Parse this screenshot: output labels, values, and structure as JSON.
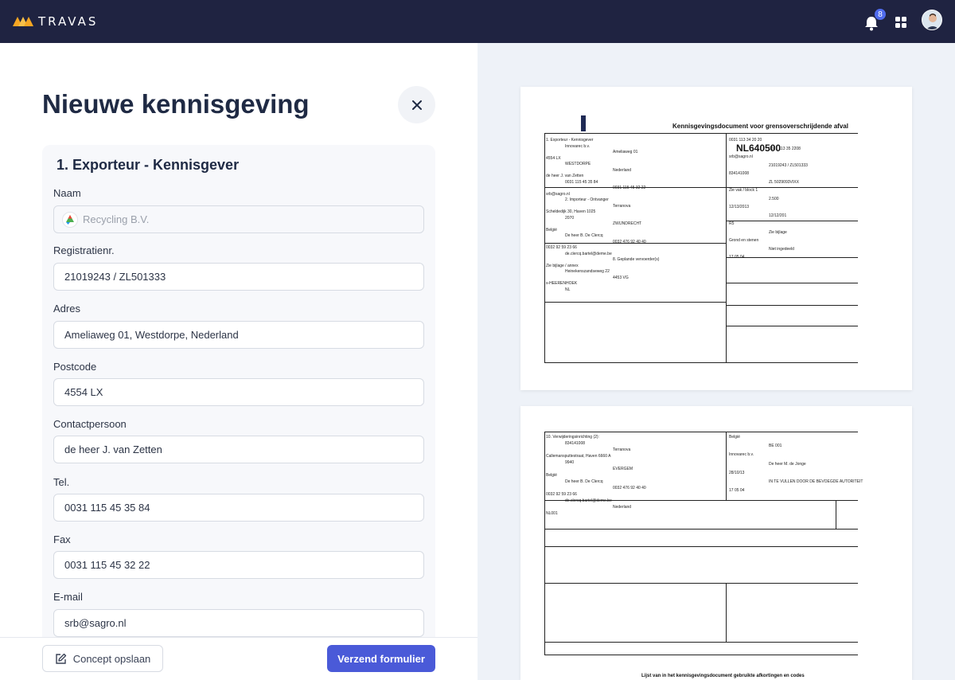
{
  "app": {
    "name": "TRAVAS",
    "notification_count": "8"
  },
  "form": {
    "title": "Nieuwe kennisgeving",
    "section_title": "1. Exporteur - Kennisgever",
    "fields": [
      {
        "label": "Naam",
        "value": "Recycling B.V."
      },
      {
        "label": "Registratienr.",
        "value": "21019243 / ZL501333"
      },
      {
        "label": "Adres",
        "value": "Ameliaweg 01, Westdorpe, Nederland"
      },
      {
        "label": "Postcode",
        "value": "4554 LX"
      },
      {
        "label": "Contactpersoon",
        "value": "de heer J. van Zetten"
      },
      {
        "label": "Tel.",
        "value": "0031 115 45 35 84"
      },
      {
        "label": "Fax",
        "value": "0031 115 45 32 22"
      },
      {
        "label": "E-mail",
        "value": "srb@sagro.nl"
      }
    ],
    "draft_button": "Concept opslaan",
    "submit_button": "Verzend formulier"
  },
  "document": {
    "title": "Kennisgevingsdocument voor grensoverschrijdende afval",
    "notification_code": "NL640500",
    "page1_lines": [
      "1. Exporteur - Kennisgever",
      "Innovarec b.v.",
      "Ameliaweg 01",
      "4554 LX",
      "WESTDORPE",
      "Nederland",
      "de heer J. van Zetten",
      "0031 115 45 35 84",
      "0031 115 45 32 22",
      "srb@sagro.nl",
      "2. Importeur - Ontvanger",
      "Terranova",
      "Scheldedijk 30, Haven 1025",
      "2070",
      "ZWIJNDRECHT",
      "België",
      "De heer B. De Clercq",
      "0032 476 92 40 40",
      "0032 92 59 23 66",
      "de.clercq.bartel@deme.be",
      "8. Geplande vervoerder(s)",
      "Zie bijlage / annex",
      "Heinekenszandseweg 22",
      "4453 VG",
      "s-HEERENHOEK",
      "NL",
      "0031 113 34 20 20",
      "0031 113 35 2208",
      "srb@sagro.nl",
      "21019243 / ZL501333",
      "834141008",
      "ZL 5029093VIXX",
      "Zie vak / block 1",
      "2.500",
      "12/13/2013",
      "12/12/201",
      "R5",
      "Zie bijlage",
      "Grond en stenen",
      "Niet ingedeeld",
      "17 05 04"
    ],
    "page2_lines": [
      "10. Verwijderingsinrichting (2):",
      "834141008",
      "Terranova",
      "Callemansputtestraat, Haven 6660 A",
      "9940",
      "EVERGEM",
      "België",
      "De heer B. De Clercq",
      "0032 476 92 40 40",
      "0032 92 59 23 66",
      "de.clercq.bartel@deme.be",
      "Nederland",
      "NL001",
      "België",
      "BE 001",
      "Innovarec b.v.",
      "De heer M. de Jonge",
      "28/10/13",
      "IN TE VULLEN DOOR DE BEVOEGDE AUTORITEIT",
      "17 05 04"
    ],
    "page2_footer": "Lijst van in het kennisgevingsdocument gebruikte afkortingen en codes"
  }
}
